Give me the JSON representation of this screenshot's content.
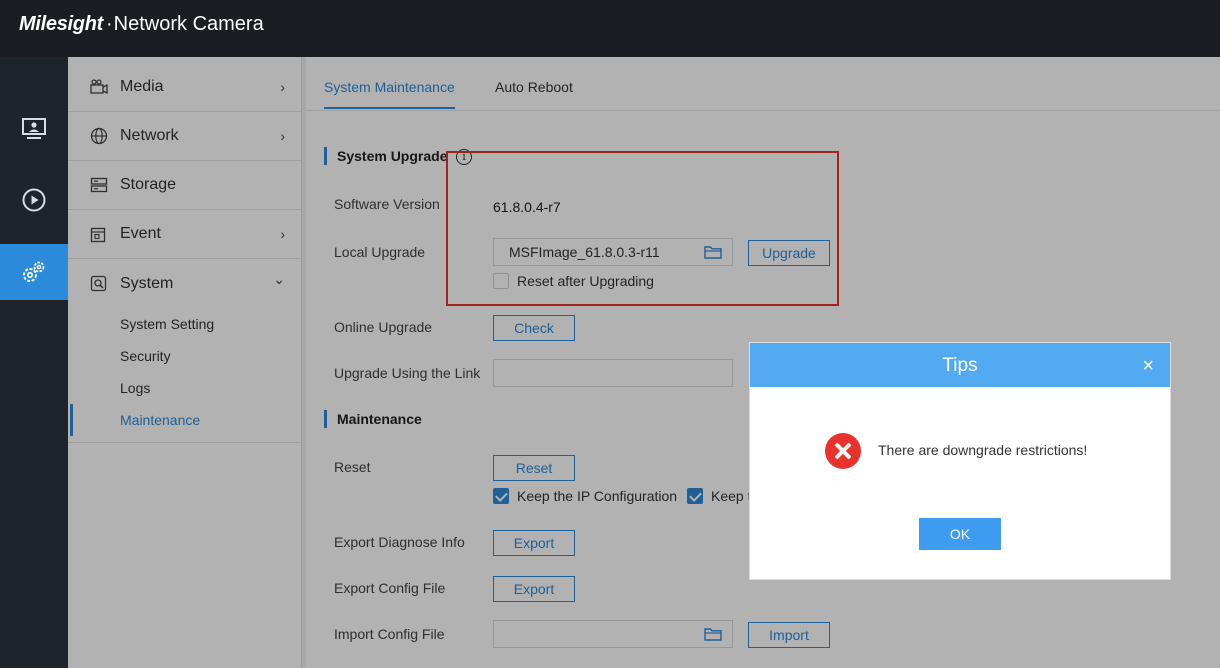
{
  "header": {
    "logo": "Milesight",
    "separator": "·",
    "product": "Network Camera"
  },
  "rail": {
    "items": [
      {
        "name": "live-view-icon",
        "active": false
      },
      {
        "name": "playback-icon",
        "active": false
      },
      {
        "name": "settings-icon",
        "active": true
      }
    ]
  },
  "sidebar": {
    "items": [
      {
        "label": "Media",
        "icon": "media-icon",
        "chevron": "›"
      },
      {
        "label": "Network",
        "icon": "network-icon",
        "chevron": "›"
      },
      {
        "label": "Storage",
        "icon": "storage-icon",
        "chevron": ""
      },
      {
        "label": "Event",
        "icon": "event-icon",
        "chevron": "›"
      },
      {
        "label": "System",
        "icon": "system-icon",
        "chevron": "⌄"
      }
    ],
    "system_sub": [
      "System Setting",
      "Security",
      "Logs",
      "Maintenance"
    ],
    "active_sub": "Maintenance"
  },
  "tabs": [
    "System Maintenance",
    "Auto Reboot"
  ],
  "upgrade": {
    "section_title": "System Upgrade",
    "software_version_label": "Software Version",
    "software_version": "61.8.0.4-r7",
    "local_upgrade_label": "Local Upgrade",
    "local_upgrade_file": "MSFImage_61.8.0.3-r11",
    "upgrade_button": "Upgrade",
    "reset_after_label": "Reset after Upgrading",
    "online_upgrade_label": "Online Upgrade",
    "check_button": "Check",
    "link_label": "Upgrade Using the Link",
    "link_value": ""
  },
  "maintenance": {
    "section_title": "Maintenance",
    "reset_label": "Reset",
    "reset_button": "Reset",
    "keep_ip_label": "Keep the IP Configuration",
    "keep_other_label": "Keep t",
    "export_diag_label": "Export Diagnose Info",
    "export_diag_button": "Export",
    "export_config_label": "Export Config File",
    "export_config_button": "Export",
    "import_config_label": "Import Config File",
    "import_config_value": "",
    "import_button": "Import"
  },
  "dialog": {
    "title": "Tips",
    "close": "×",
    "message": "There are downgrade restrictions!",
    "ok": "OK"
  },
  "colors": {
    "accent": "#2b8ad9",
    "dialog_header": "#52aaf1",
    "error": "#e8322d",
    "topbar": "#1b1d23"
  }
}
